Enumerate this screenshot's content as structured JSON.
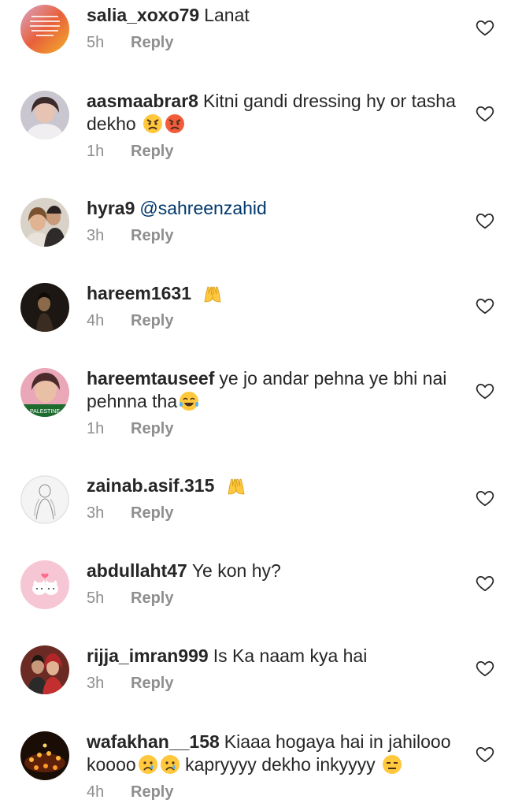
{
  "comments": [
    {
      "username": "salia_xoxo79",
      "text": "Lanat",
      "time": "5h",
      "reply": "Reply",
      "avatar_icon": "quote-text-avatar-icon"
    },
    {
      "username": "aasmaabrar8",
      "text": "Kitni gandi dressing hy or tasha dekho",
      "emojis": [
        "angry-face",
        "angry-face"
      ],
      "time": "1h",
      "reply": "Reply",
      "avatar_icon": "portrait-avatar-icon"
    },
    {
      "username": "hyra9",
      "mention": "@sahreenzahid",
      "time": "3h",
      "reply": "Reply",
      "avatar_icon": "couple-photo-avatar-icon"
    },
    {
      "username": "hareem1631",
      "text": "",
      "emojis": [
        "raising-hands"
      ],
      "time": "4h",
      "reply": "Reply",
      "avatar_icon": "dark-portrait-avatar-icon"
    },
    {
      "username": "hareemtauseef",
      "text": "ye jo andar pehna ye bhi nai pehnna tha",
      "emojis": [
        "tears-of-joy"
      ],
      "time": "1h",
      "reply": "Reply",
      "avatar_icon": "selfie-avatar-icon",
      "avatar_caption": "PALESTINE"
    },
    {
      "username": "zainab.asif.315",
      "text": "",
      "emojis": [
        "raising-hands"
      ],
      "time": "3h",
      "reply": "Reply",
      "avatar_icon": "sketch-avatar-icon"
    },
    {
      "username": "abdullaht47",
      "text": "Ye kon hy?",
      "time": "5h",
      "reply": "Reply",
      "avatar_icon": "cartoon-cats-avatar-icon"
    },
    {
      "username": "rijja_imran999",
      "text": "Is Ka naam kya hai",
      "time": "3h",
      "reply": "Reply",
      "avatar_icon": "bridal-photo-avatar-icon"
    },
    {
      "username": "wafakhan__158",
      "text": "Kiaaa hogaya hai in jahilooo koooo",
      "text_after": "kapryyyy dekho inkyyyy",
      "emojis": [
        "crying-face",
        "crying-face"
      ],
      "emojis_after": [
        "expressionless-face"
      ],
      "time": "4h",
      "reply": "Reply",
      "avatar_icon": "candles-avatar-icon"
    }
  ],
  "like_icon": "heart-outline-icon",
  "colors": {
    "text": "#262626",
    "meta": "#8e8e8e",
    "mention": "#00376b",
    "emoji_yellow": "#ffc83d"
  }
}
